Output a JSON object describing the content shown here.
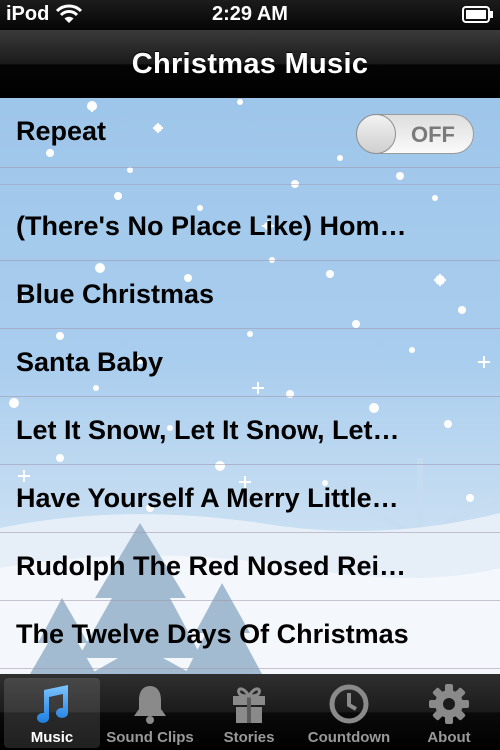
{
  "status_bar": {
    "carrier": "iPod",
    "time": "2:29 AM"
  },
  "nav": {
    "title": "Christmas Music"
  },
  "settings": {
    "repeat_label": "Repeat",
    "repeat_state": "OFF"
  },
  "songs": [
    "(There's No Place Like) Hom…",
    "Blue Christmas",
    "Santa Baby",
    "Let It Snow, Let It Snow, Let…",
    "Have Yourself A Merry Little…",
    "Rudolph The Red Nosed Rei…",
    "The Twelve Days Of Christmas"
  ],
  "tabs": [
    {
      "label": "Music",
      "icon": "music-note-icon",
      "selected": true
    },
    {
      "label": "Sound Clips",
      "icon": "bell-icon",
      "selected": false
    },
    {
      "label": "Stories",
      "icon": "gift-icon",
      "selected": false
    },
    {
      "label": "Countdown",
      "icon": "clock-icon",
      "selected": false
    },
    {
      "label": "About",
      "icon": "gear-icon",
      "selected": false
    }
  ],
  "colors": {
    "accent_blue": "#3aa0f0",
    "sky": "#a9cdee"
  }
}
